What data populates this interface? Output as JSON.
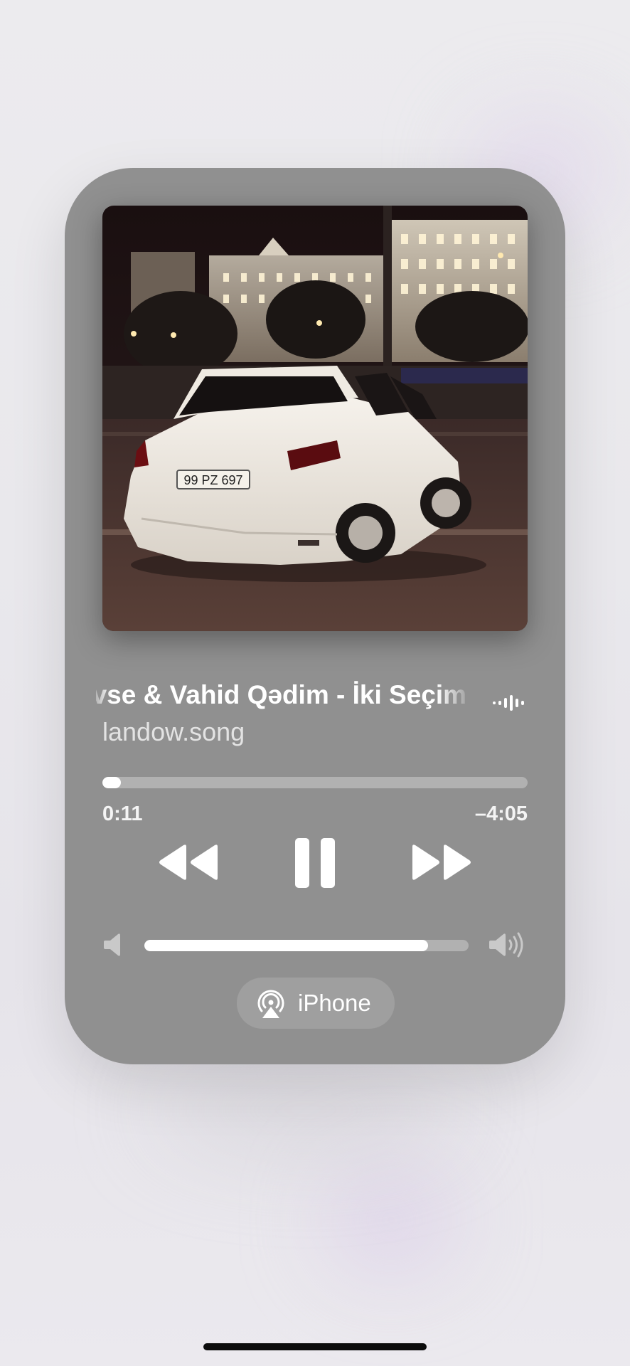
{
  "now_playing": {
    "title": "Lvse & Vahid Qədim - İki Seçim",
    "artist": "landow.song",
    "artwork_icon": "car-at-night-photo",
    "elapsed": "0:11",
    "remaining": "–4:05",
    "progress_fraction": 0.043
  },
  "controls": {
    "rewind_icon": "backward-icon",
    "pause_icon": "pause-icon",
    "forward_icon": "forward-icon"
  },
  "volume": {
    "level_fraction": 0.874,
    "low_icon": "speaker-low-icon",
    "high_icon": "speaker-high-icon"
  },
  "output_route": {
    "icon": "airplay-icon",
    "label": "iPhone"
  },
  "colors": {
    "card_background": "#909090",
    "track_fill": "#ffffff",
    "track_empty": "#b1b1b1"
  }
}
